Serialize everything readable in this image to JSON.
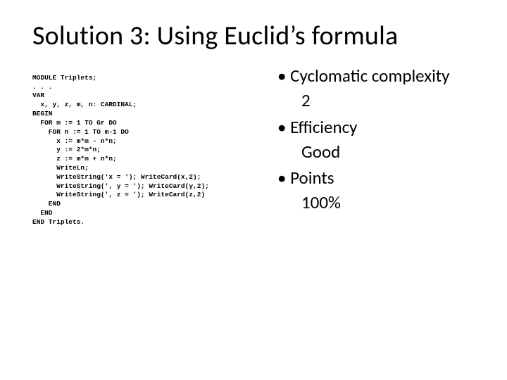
{
  "title": "Solution 3: Using Euclid’s formula",
  "code": {
    "l00": "MODULE Triplets;",
    "l01": ". . .",
    "l02": "VAR",
    "l03": "  x, y, z, m, n: CARDINAL;",
    "l04": "BEGIN",
    "l05": "  FOR m := 1 TO Gr DO",
    "l06": "    FOR n := 1 TO m-1 DO",
    "l07": "      x := m*m - n*n;",
    "l08": "      y := 2*m*n;",
    "l09": "      z := m*m + n*n;",
    "l10": "      WriteLn;",
    "l11": "      WriteString('x = '); WriteCard(x,2);",
    "l12": "      WriteString(', y = '); WriteCard(y,2);",
    "l13": "      WriteString(', z = '); WriteCard(z,2)",
    "l14": "    END",
    "l15": "  END",
    "l16": "END Triplets."
  },
  "bullets": {
    "b0": "Cyclomatic complexity",
    "b0sub": "2",
    "b1": "Efficiency",
    "b1sub": "Good",
    "b2": "Points",
    "b2sub": "100%"
  }
}
